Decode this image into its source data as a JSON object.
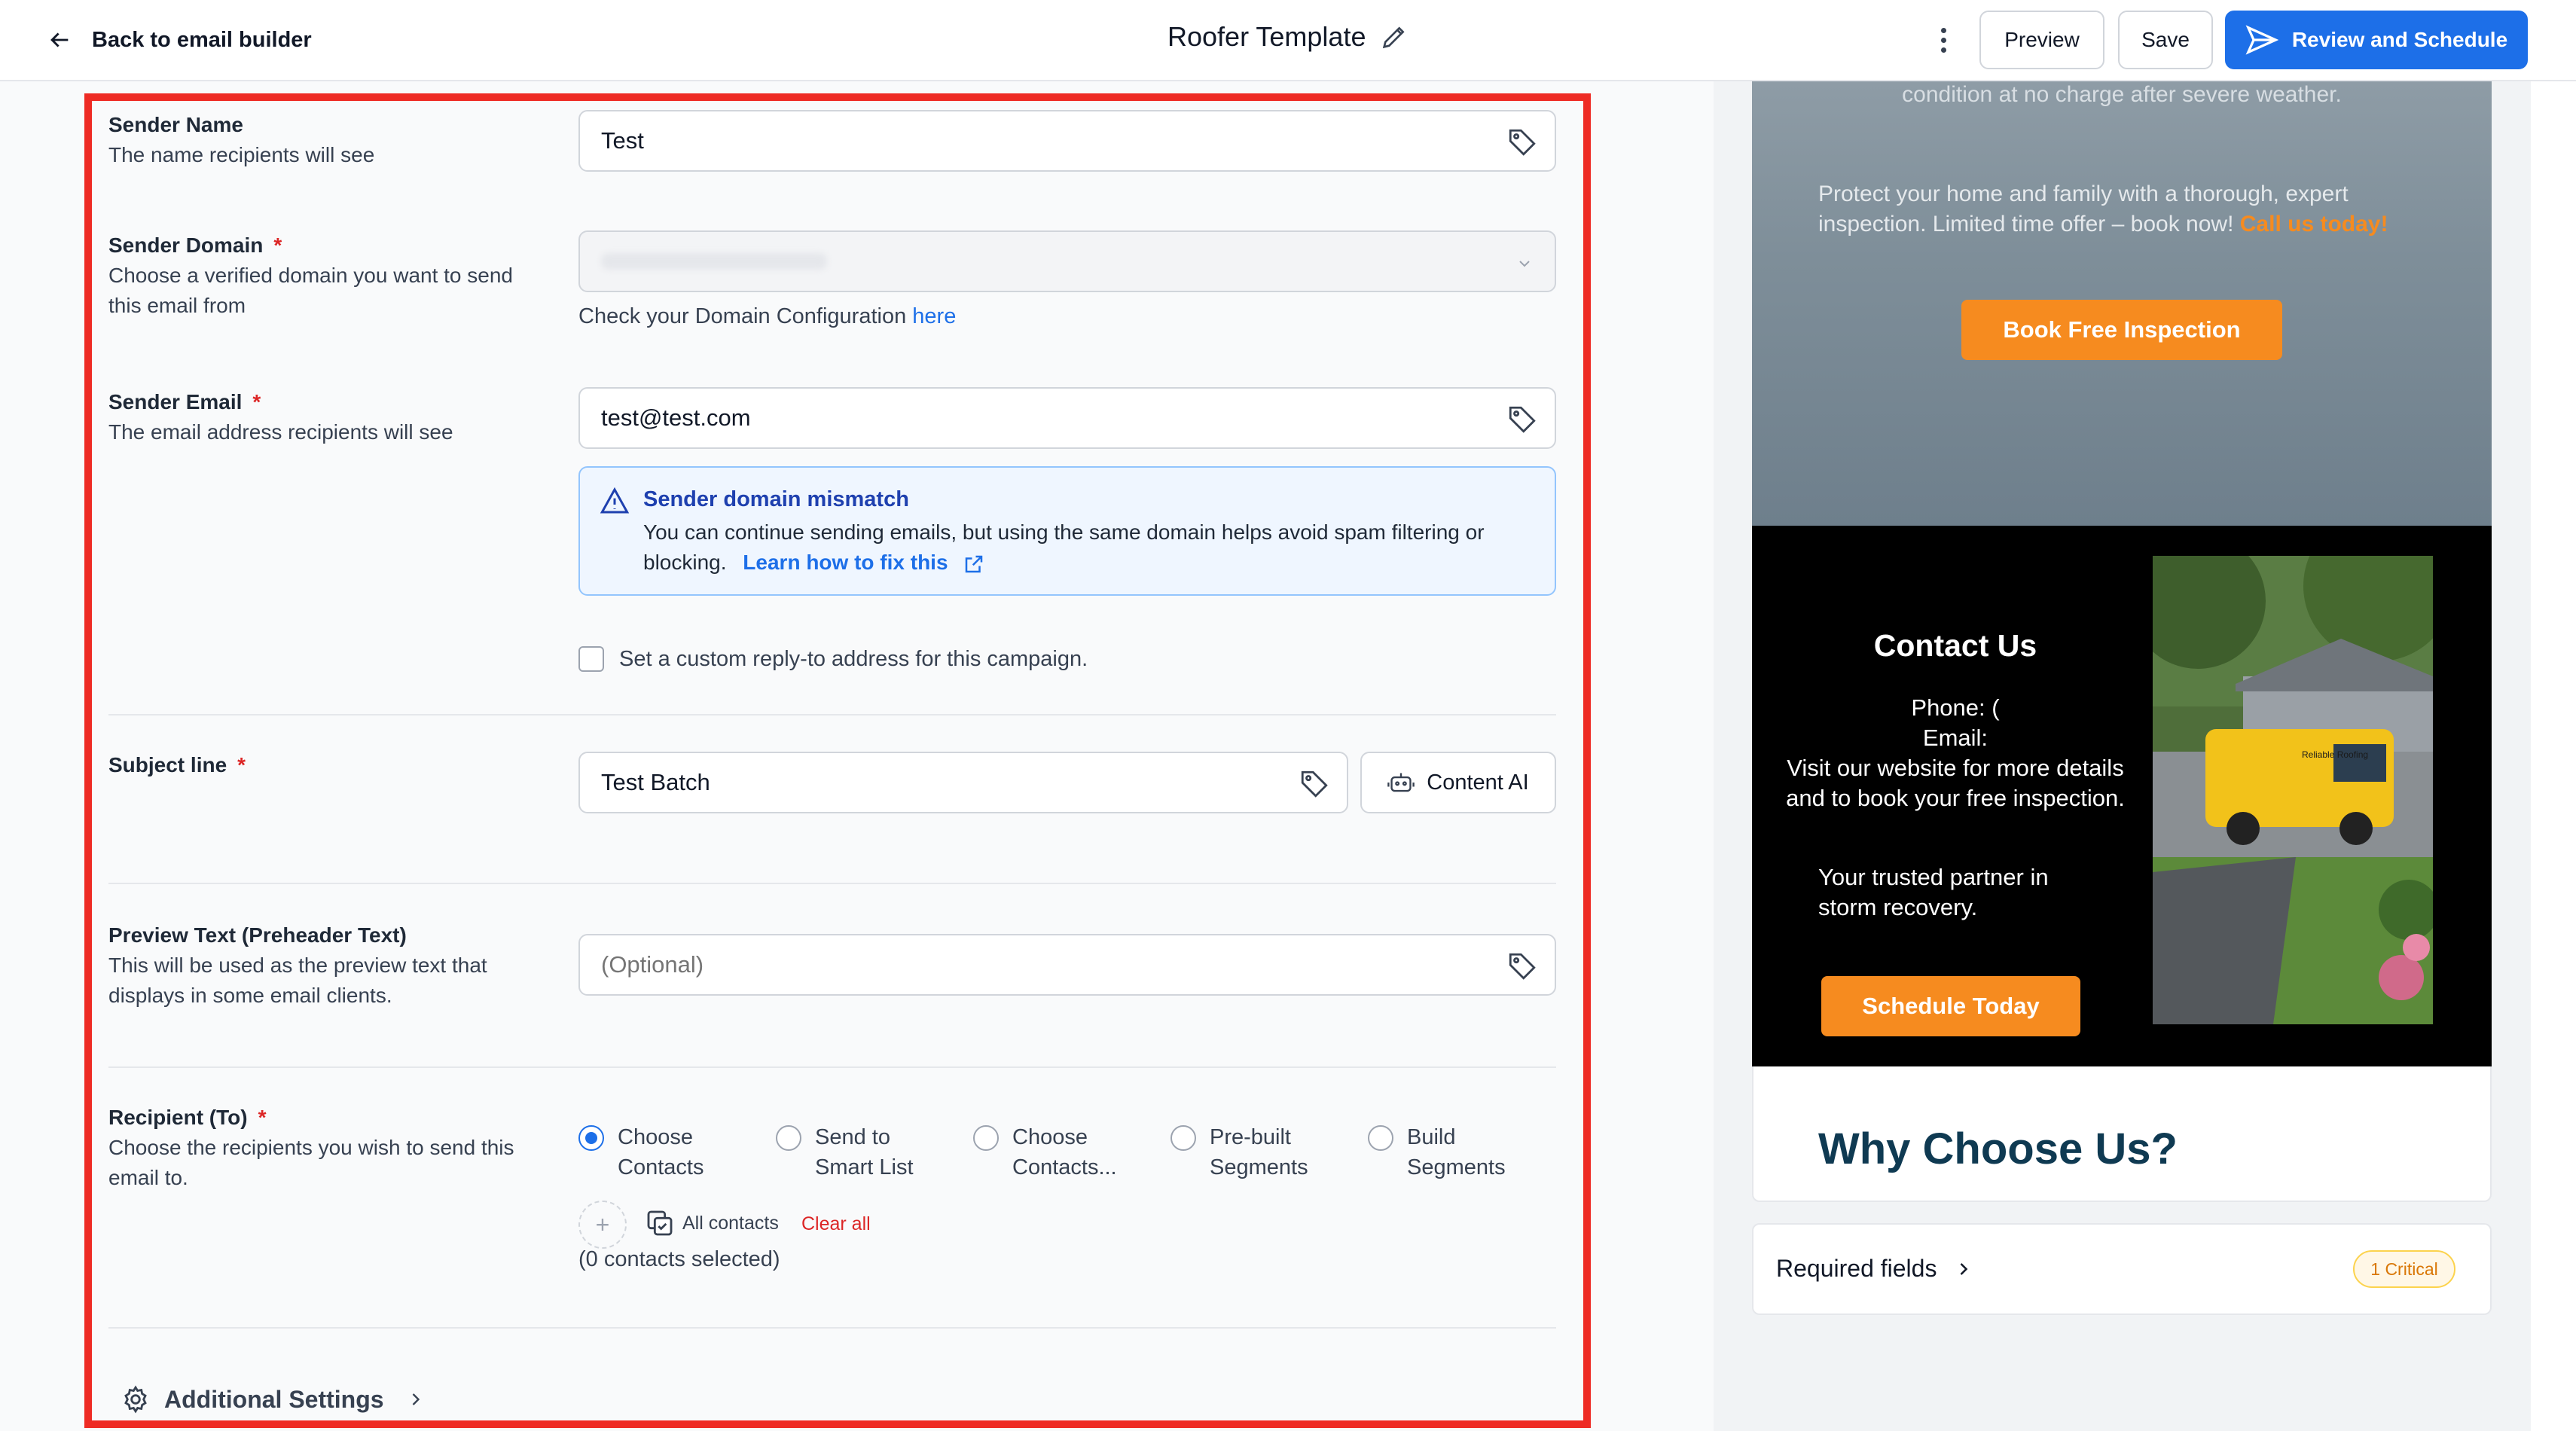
{
  "header": {
    "back_label": "Back to email builder",
    "title": "Roofer Template",
    "preview_label": "Preview",
    "save_label": "Save",
    "review_label": "Review and Schedule"
  },
  "form": {
    "sender_name": {
      "label": "Sender Name",
      "help": "The name recipients will see",
      "value": "Test"
    },
    "sender_domain": {
      "label": "Sender Domain",
      "required_mark": "*",
      "help": "Choose a verified domain you want to send this email from",
      "helper_prefix": "Check your Domain Configuration",
      "helper_link": "here"
    },
    "sender_email": {
      "label": "Sender Email",
      "required_mark": "*",
      "help": "The email address recipients will see",
      "value": "test@test.com"
    },
    "alert": {
      "title": "Sender domain mismatch",
      "body": "You can continue sending emails, but using the same domain helps avoid spam filtering or blocking.",
      "link": "Learn how to fix this"
    },
    "reply_to_label": "Set a custom reply-to address for this campaign.",
    "subject": {
      "label": "Subject line",
      "required_mark": "*",
      "value": "Test Batch",
      "content_ai_label": "Content AI"
    },
    "preview_text": {
      "label": "Preview Text (Preheader Text)",
      "help": "This will be used as the preview text that displays in some email clients.",
      "placeholder": "(Optional)"
    },
    "recipient": {
      "label": "Recipient (To)",
      "required_mark": "*",
      "help": "Choose the recipients you wish to send this email to.",
      "options": [
        {
          "line1": "Choose",
          "line2": "Contacts",
          "selected": true
        },
        {
          "line1": "Send to",
          "line2": "Smart List",
          "selected": false
        },
        {
          "line1": "Choose",
          "line2": "Contacts...",
          "selected": false
        },
        {
          "line1": "Pre-built",
          "line2": "Segments",
          "selected": false
        },
        {
          "line1": "Build",
          "line2": "Segments",
          "selected": false
        }
      ],
      "all_contacts": "All contacts",
      "clear_all": "Clear all",
      "selected_count": "(0 contacts selected)"
    },
    "additional_settings": "Additional Settings"
  },
  "preview": {
    "hero_top": "condition at no charge after severe weather.",
    "hero_text": "Protect your home and family with a thorough, expert inspection. Limited time offer – book now!",
    "hero_cta_text": "Call us today!",
    "book_button": "Book Free Inspection",
    "contact_title": "Contact Us",
    "contact_phone": "Phone: (",
    "contact_email": "Email:",
    "contact_visit": "Visit our website for more details and to book your free inspection.",
    "contact_partner": "Your trusted partner in storm recovery.",
    "schedule_button": "Schedule Today",
    "why_title": "Why Choose Us?",
    "truck_brand": "Reliable Roofing",
    "required_fields": "Required fields",
    "critical_badge": "1 Critical"
  },
  "colors": {
    "primary": "#1d6fe8",
    "accent_orange": "#f68b1f",
    "highlight_border": "#ee2b24",
    "required": "#dc2626",
    "why_title": "#0f3a52"
  }
}
